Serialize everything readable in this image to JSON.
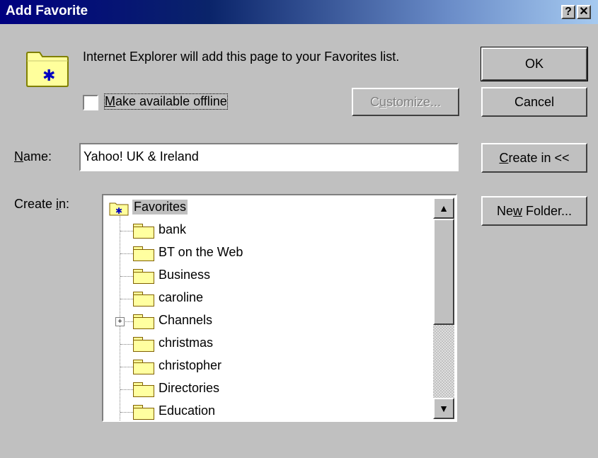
{
  "dialog": {
    "title": "Add Favorite",
    "help_button": "?",
    "close_button": "✕",
    "message": "Internet Explorer will add this page to your Favorites list.",
    "offline_checkbox": {
      "label_prefix": "",
      "label_underlined": "M",
      "label_rest": "ake available offline",
      "checked": false
    },
    "customize_button": {
      "underlined": "u",
      "prefix": "C",
      "rest": "stomize...",
      "enabled": false
    },
    "name_label": {
      "underlined": "N",
      "rest": "ame:"
    },
    "name_value": "Yahoo! UK & Ireland",
    "create_in_label": {
      "prefix": "Create ",
      "underlined": "i",
      "rest": "n:"
    },
    "buttons": {
      "ok": "OK",
      "cancel": "Cancel",
      "create_in": {
        "underlined": "C",
        "rest": "reate in <<"
      },
      "new_folder": {
        "prefix": "Ne",
        "underlined": "w",
        "rest": " Folder..."
      }
    },
    "tree": {
      "root": "Favorites",
      "items": [
        "bank",
        "BT on the Web",
        "Business",
        "caroline",
        "Channels",
        "christmas",
        "christopher",
        "Directories",
        "Education"
      ],
      "expandable_item": "Channels"
    },
    "scrollbar": {
      "up_arrow": "▲",
      "down_arrow": "▼"
    }
  }
}
